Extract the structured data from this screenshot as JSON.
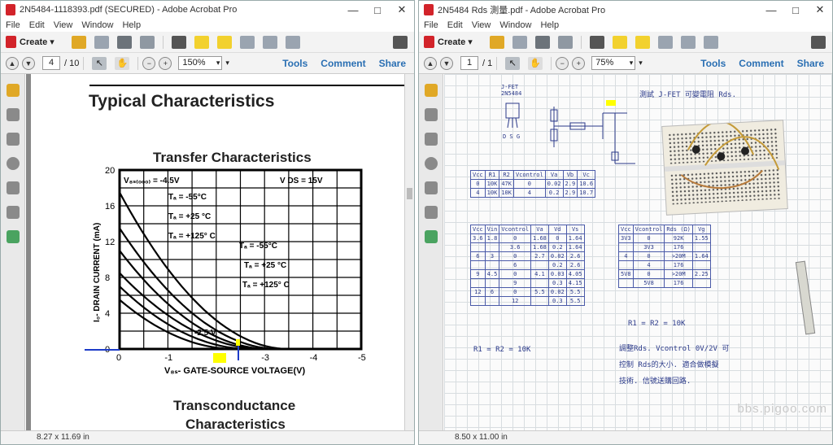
{
  "left": {
    "title": "2N5484-1118393.pdf (SECURED) - Adobe Acrobat Pro",
    "menu": [
      "File",
      "Edit",
      "View",
      "Window",
      "Help"
    ],
    "create_label": "Create",
    "page_current": "4",
    "page_total": "/ 10",
    "zoom": "150%",
    "tools_label": "Tools",
    "comment_label": "Comment",
    "share_label": "Share",
    "page_size": "8.27 x 11.69 in",
    "doc": {
      "heading": "Typical Characteristics",
      "chart_title": "Transfer Characteristics",
      "next_title_1": "Transconductance",
      "next_title_2": "Characteristics",
      "ylabel": "I₀- DRAIN CURRENT (mA)",
      "xlabel": "V₈ₛ- GATE-SOURCE VOLTAGE(V)",
      "x_ticks": [
        "0",
        "-1",
        "-2",
        "-3",
        "-4",
        "-5"
      ],
      "y_ticks": [
        "0",
        "4",
        "8",
        "12",
        "16",
        "20"
      ],
      "annotations": {
        "vgsoff": "V₈ₛ₍ₒₒₒ₎ = -4.5V",
        "vds": "V DS     = 15V",
        "ta1": "Tₐ = -55°C",
        "ta2": "Tₐ = +25 °C",
        "ta3": "Tₐ = +125° C",
        "ta4": "Tₐ = -55°C",
        "ta5": "Tₐ = +25 °C",
        "ta6": "Tₐ = +125° C",
        "vgs25": "-2.5 V"
      }
    }
  },
  "right": {
    "title": "2N5484 Rds 測量.pdf - Adobe Acrobat Pro",
    "menu": [
      "File",
      "Edit",
      "View",
      "Window",
      "Help"
    ],
    "create_label": "Create",
    "page_current": "1",
    "page_total": "/ 1",
    "zoom": "75%",
    "tools_label": "Tools",
    "comment_label": "Comment",
    "share_label": "Share",
    "page_size": "8.50 x 11.00 in",
    "notes": {
      "title": "測試 J-FET 可變電阻 Rds.",
      "part": "J-FET\n2N5484",
      "pins": "D  S  G",
      "r_eq": "R1 = R2 = 10K",
      "r_eq2": "R1 = R2 = 10K",
      "remark1": "調整Rds. Vcontrol 0V/2V 可",
      "remark2": "控制 Rds的大小. 適合做模擬",
      "remark3": "技術. 信號送購回路.",
      "watermark": "bbs.pigoo.com"
    },
    "table1": {
      "headers": [
        "Vcc",
        "R1",
        "R2",
        "Vcontrol",
        "Va",
        "Vb",
        "Vc"
      ],
      "rows": [
        [
          "0",
          "10K",
          "47K",
          "0",
          "0.02",
          "2.9",
          "10.6"
        ],
        [
          "4",
          "10K",
          "10K",
          "4",
          "0.2",
          "2.9",
          "10.7"
        ]
      ]
    },
    "table2": {
      "headers": [
        "Vcc",
        "Vin",
        "Vcontrol",
        "Va",
        "Vd",
        "Vs"
      ],
      "rows": [
        [
          "3.6",
          "1.8",
          "0",
          "1.68",
          "0",
          "1.64"
        ],
        [
          "",
          "",
          "3.6",
          "1.68",
          "0.2",
          "1.64"
        ],
        [
          "6",
          "3",
          "0",
          "2.7",
          "0.02",
          "2.6"
        ],
        [
          "",
          "",
          "6",
          "",
          "0.2",
          "2.6"
        ],
        [
          "9",
          "4.5",
          "0",
          "4.1",
          "0.03",
          "4.05"
        ],
        [
          "",
          "",
          "9",
          "",
          "0.3",
          "4.15"
        ],
        [
          "12",
          "6",
          "0",
          "5.5",
          "0.02",
          "5.5"
        ],
        [
          "",
          "",
          "12",
          "",
          "0.3",
          "5.5"
        ]
      ]
    },
    "table3": {
      "headers": [
        "Vcc",
        "Vcontrol",
        "Rds (Ω)",
        "Vg"
      ],
      "rows": [
        [
          "3V3",
          "0",
          "92K",
          "1.55"
        ],
        [
          "",
          "3V3",
          "176",
          ""
        ],
        [
          "4",
          "0",
          ">20M",
          "1.64"
        ],
        [
          "",
          "4",
          "176",
          ""
        ],
        [
          "5V8",
          "0",
          ">20M",
          "2.25"
        ],
        [
          "",
          "5V8",
          "176",
          ""
        ]
      ]
    }
  }
}
